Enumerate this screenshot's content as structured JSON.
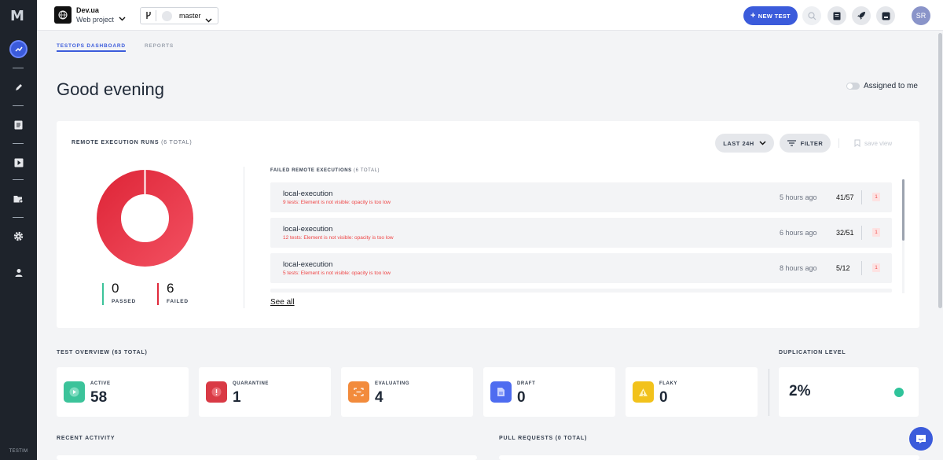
{
  "sidebar": {
    "logo": "M",
    "footer": "TESTIM",
    "icons": [
      "dashboard-icon",
      "pencil-icon",
      "list-icon",
      "play-icon",
      "folder-settings-icon",
      "gear-icon",
      "user-icon"
    ]
  },
  "topbar": {
    "project_name": "Dev.ua",
    "project_sub": "Web project",
    "branch": "master",
    "new_test": "NEW TEST",
    "avatar": "SR",
    "accent": "#3b5bdb"
  },
  "tabs": [
    "TESTOPS DASHBOARD",
    "REPORTS"
  ],
  "greeting": "Good evening",
  "assigned_label": "Assigned to me",
  "remote": {
    "title": "REMOTE EXECUTION RUNS",
    "title_count": "(6 TOTAL)",
    "range": "LAST 24H",
    "filter": "FILTER",
    "save_view": "save view",
    "passed_value": "0",
    "passed_label": "PASSED",
    "failed_value": "6",
    "failed_label": "FAILED",
    "failed_title": "FAILED REMOTE EXECUTIONS",
    "failed_count": "(6 TOTAL)",
    "rows": [
      {
        "name": "local-execution",
        "error": "9 tests: Element is not visible: opacity is too low",
        "time": "5 hours ago",
        "count": "41/57",
        "badge": "1"
      },
      {
        "name": "local-execution",
        "error": "12 tests: Element is not visible: opacity is too low",
        "time": "6 hours ago",
        "count": "32/51",
        "badge": "1"
      },
      {
        "name": "local-execution",
        "error": "5 tests: Element is not visible: opacity is too low",
        "time": "8 hours ago",
        "count": "5/12",
        "badge": "1"
      }
    ],
    "see_all": "See all"
  },
  "overview": {
    "title": "TEST OVERVIEW (63 TOTAL)",
    "cards": [
      {
        "label": "ACTIVE",
        "value": "58",
        "icon": "play-icon",
        "color": "#3cc39a"
      },
      {
        "label": "QUARANTINE",
        "value": "1",
        "icon": "alert-icon",
        "color": "#d93a45"
      },
      {
        "label": "EVALUATING",
        "value": "4",
        "icon": "scan-icon",
        "color": "#f28b3c"
      },
      {
        "label": "DRAFT",
        "value": "0",
        "icon": "document-icon",
        "color": "#4e6cf0"
      },
      {
        "label": "FLAKY",
        "value": "0",
        "icon": "warning-icon",
        "color": "#f2c21b"
      }
    ]
  },
  "duplication": {
    "title": "DUPLICATION LEVEL",
    "value": "2%"
  },
  "recent_activity": "RECENT ACTIVITY",
  "pull_requests": "PULL REQUESTS (0 TOTAL)"
}
